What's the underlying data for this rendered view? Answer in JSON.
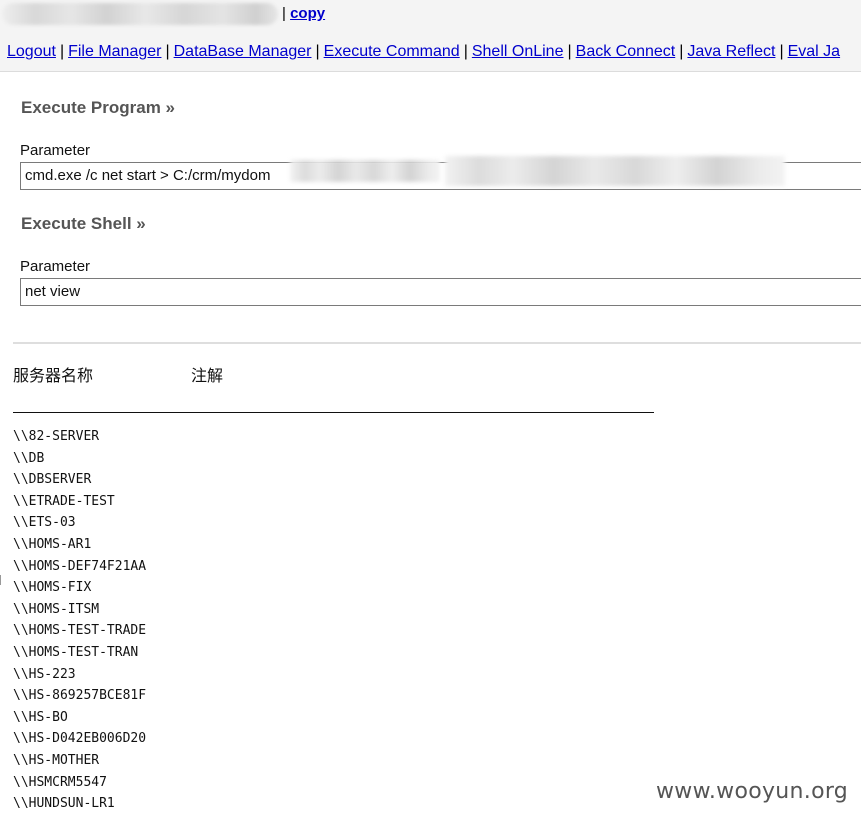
{
  "topbar": {
    "separator": "|",
    "copy_label": "copy"
  },
  "nav": {
    "items": [
      {
        "label": "Logout"
      },
      {
        "label": "File Manager"
      },
      {
        "label": "DataBase Manager"
      },
      {
        "label": "Execute Command"
      },
      {
        "label": "Shell OnLine"
      },
      {
        "label": "Back Connect"
      },
      {
        "label": "Java Reflect"
      },
      {
        "label": "Eval Ja"
      }
    ],
    "separator": "|"
  },
  "execute_program": {
    "title": "Execute Program »",
    "param_label": "Parameter",
    "value": "cmd.exe /c net start > C:/crm/mydom"
  },
  "execute_shell": {
    "title": "Execute Shell »",
    "param_label": "Parameter",
    "value": "net view"
  },
  "output": {
    "col1_header": "服务器名称",
    "col2_header": "注解",
    "rows": [
      "\\\\82-SERVER",
      "\\\\DB",
      "\\\\DBSERVER",
      "\\\\ETRADE-TEST",
      "\\\\ETS-03",
      "\\\\HOMS-AR1",
      "\\\\HOMS-DEF74F21AA",
      "\\\\HOMS-FIX",
      "\\\\HOMS-ITSM",
      "\\\\HOMS-TEST-TRADE",
      "\\\\HOMS-TEST-TRAN",
      "\\\\HS-223",
      "\\\\HS-869257BCE81F",
      "\\\\HS-BO",
      "\\\\HS-D042EB006D20",
      "\\\\HS-MOTHER",
      "\\\\HSMCRM5547",
      "\\\\HUNDSUN-LR1"
    ]
  },
  "watermark": "www.wooyun.org"
}
